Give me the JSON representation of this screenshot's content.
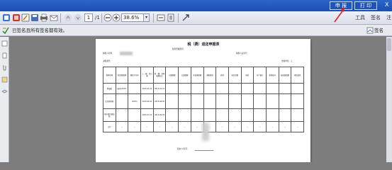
{
  "topbar": {
    "apply_label": "申 报",
    "print_label": "打 印",
    "close_label": "X"
  },
  "toolbar": {
    "page_current": "1",
    "page_total": "/1",
    "zoom": "38.6%",
    "tools_label": "工具",
    "sign_label": "签名",
    "comment_label": "注"
  },
  "signature_bar": {
    "message": "已签名且所有签名都有效。",
    "panel_label": "签名"
  },
  "document": {
    "title": "税（费）退还申报表",
    "meta_left": "填表日期：",
    "meta_center": "税款所属期间：",
    "meta_right_a": "纳税人识别号：",
    "meta_right_b": "金额单位：元",
    "row_label_name": "纳税人名称：",
    "row_label_b": "退税类型：",
    "headers": [
      "税种名称",
      "税款所属期",
      "缴款书号码",
      "入（退）库日期",
      "税（费）款所属期起止",
      "已缴税额",
      "已退税额",
      "申请退税额",
      "退税原因",
      "其他",
      "退库金额",
      "国库",
      "开户银行",
      "收款账号",
      "核准退税额",
      "审核意见"
    ],
    "rows": [
      [
        "增值税",
        "国内(2015)",
        "",
        "2015-01-01",
        "2015-03-31",
        "",
        "",
        "",
        "",
        "",
        "",
        "",
        "",
        "",
        "",
        ""
      ],
      [
        "企业所得税",
        "",
        "(2015)",
        "2015-04-01",
        "2015-06-30",
        "",
        "",
        "",
        "",
        "",
        "",
        "",
        "",
        "",
        "",
        ""
      ],
      [
        "城市维护建设税",
        "",
        "",
        "2015-07-01",
        "2015-09-30",
        "",
        "",
        "",
        "",
        "",
        "",
        "",
        "",
        "",
        "",
        ""
      ],
      [
        "合计",
        "--",
        "--",
        "--",
        "--",
        "--",
        "--",
        "--",
        "--",
        "--",
        "--",
        "--",
        "--",
        "--",
        "--",
        "--"
      ]
    ],
    "footer_label": "经办人签字："
  },
  "colors": {
    "top_bar": "#2c66c9",
    "toolbar": "#e3e7ef",
    "background": "#7d7d7d",
    "arrow": "#e02020"
  }
}
